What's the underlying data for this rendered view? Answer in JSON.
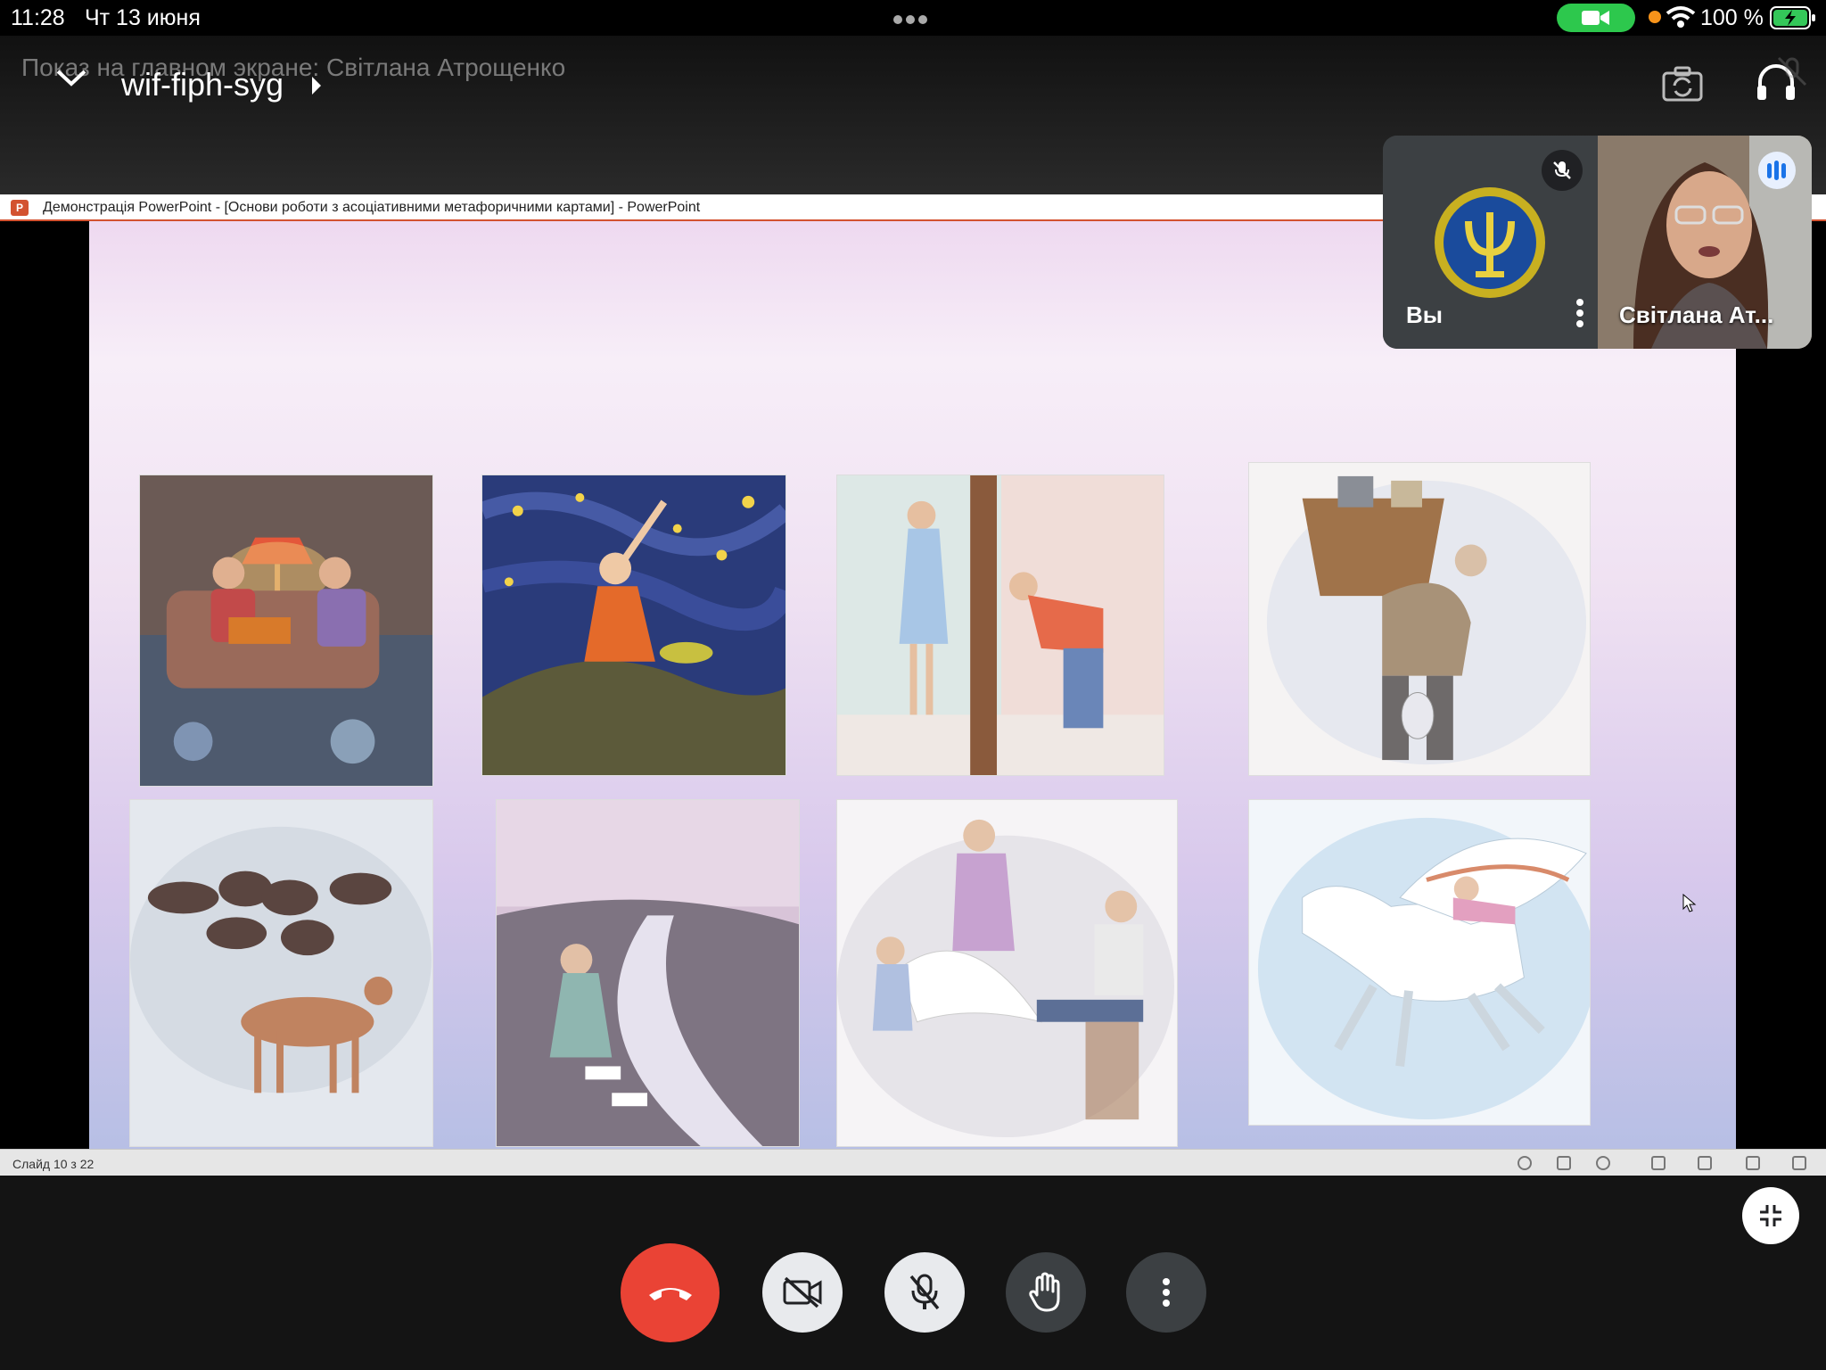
{
  "status_bar": {
    "time": "11:28",
    "date": "Чт 13 июня",
    "battery_percent": "100 %",
    "camera_indicator_color": "#2dc84d",
    "mic_indicator_color": "#f7931a"
  },
  "header": {
    "presenting_label": "Показ на главном экране: Світлана Атрощенко",
    "meeting_code": "wif-fiph-syg",
    "icons": [
      "chevron-down-icon",
      "switch-camera-icon",
      "headphones-icon"
    ]
  },
  "presentation": {
    "window_title": "Демонстрація PowerPoint - [Основи роботи з асоціативними метафоричними картами] - PowerPoint",
    "app_badge": "P",
    "slide_counter": "Слайд 10 з 22",
    "cards": [
      "family-reading-card",
      "girl-starry-night-card",
      "door-peeking-card",
      "old-man-basket-card",
      "dogs-pack-card",
      "girl-riverside-card",
      "angel-wings-card",
      "pegasus-rider-card"
    ]
  },
  "participants": {
    "self": {
      "name": "Вы",
      "muted": true
    },
    "remote": {
      "name": "Світлана Ат...",
      "speaking": true
    }
  },
  "controls": {
    "buttons": [
      "end-call",
      "camera-off",
      "mic-off",
      "raise-hand",
      "more-options"
    ],
    "end_call_color": "#ea4335"
  }
}
